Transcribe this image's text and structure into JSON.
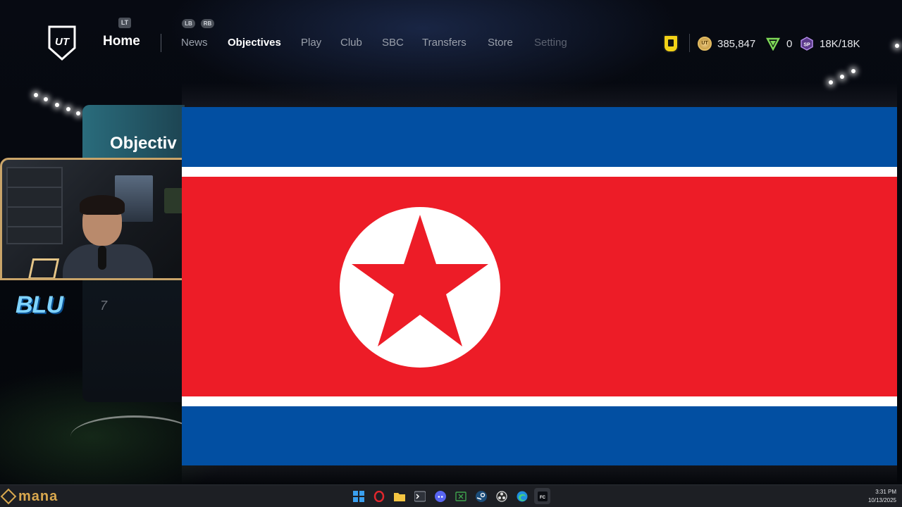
{
  "nav": {
    "lt_badge": "LT",
    "lb_badge": "LB",
    "rb_badge": "RB",
    "home": "Home",
    "items": [
      "News",
      "Objectives",
      "Play",
      "Club",
      "SBC",
      "Transfers",
      "Store",
      "Setting"
    ],
    "active_item": "Objectives"
  },
  "currency": {
    "coins": "385,847",
    "points": "0",
    "sp": "18K/18K",
    "coin_icon_label": "UT",
    "sp_icon_label": "SP"
  },
  "objectives_card": {
    "title": "Objectiv"
  },
  "overlay": {
    "brand_text": "BLU",
    "brand_sub": "7"
  },
  "flag": {
    "colors": {
      "blue": "#024fa2",
      "white": "#ffffff",
      "red": "#ed1c27"
    }
  },
  "taskbar": {
    "mana_text": "mana",
    "time": "3:31 PM",
    "date": "10/13/2025",
    "icons": [
      "windows-icon",
      "opera-icon",
      "file-explorer-icon",
      "terminal-icon",
      "discord-icon",
      "xbox-icon",
      "steam-icon",
      "obs-icon",
      "edge-icon",
      "fc-game-icon"
    ]
  }
}
